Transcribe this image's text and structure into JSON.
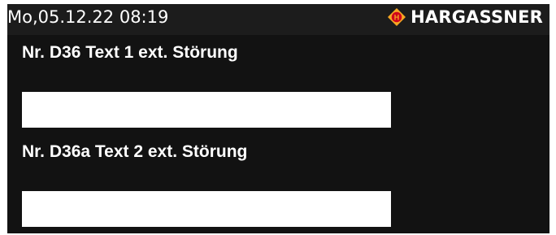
{
  "header": {
    "datetime": "Mo,05.12.22 08:19",
    "brand_icon": "hargassner-logo-icon",
    "brand_name": "HARGASSNER"
  },
  "fields": [
    {
      "label": "Nr. D36 Text 1 ext. Störung",
      "value": ""
    },
    {
      "label": "Nr. D36a Text 2 ext. Störung",
      "value": ""
    }
  ],
  "colors": {
    "topbar_bg": "#1c1c1c",
    "panel_bg": "#121212",
    "text": "#ffffff",
    "input_bg": "#ffffff",
    "logo_orange": "#f5a623",
    "logo_red": "#d0021b"
  }
}
